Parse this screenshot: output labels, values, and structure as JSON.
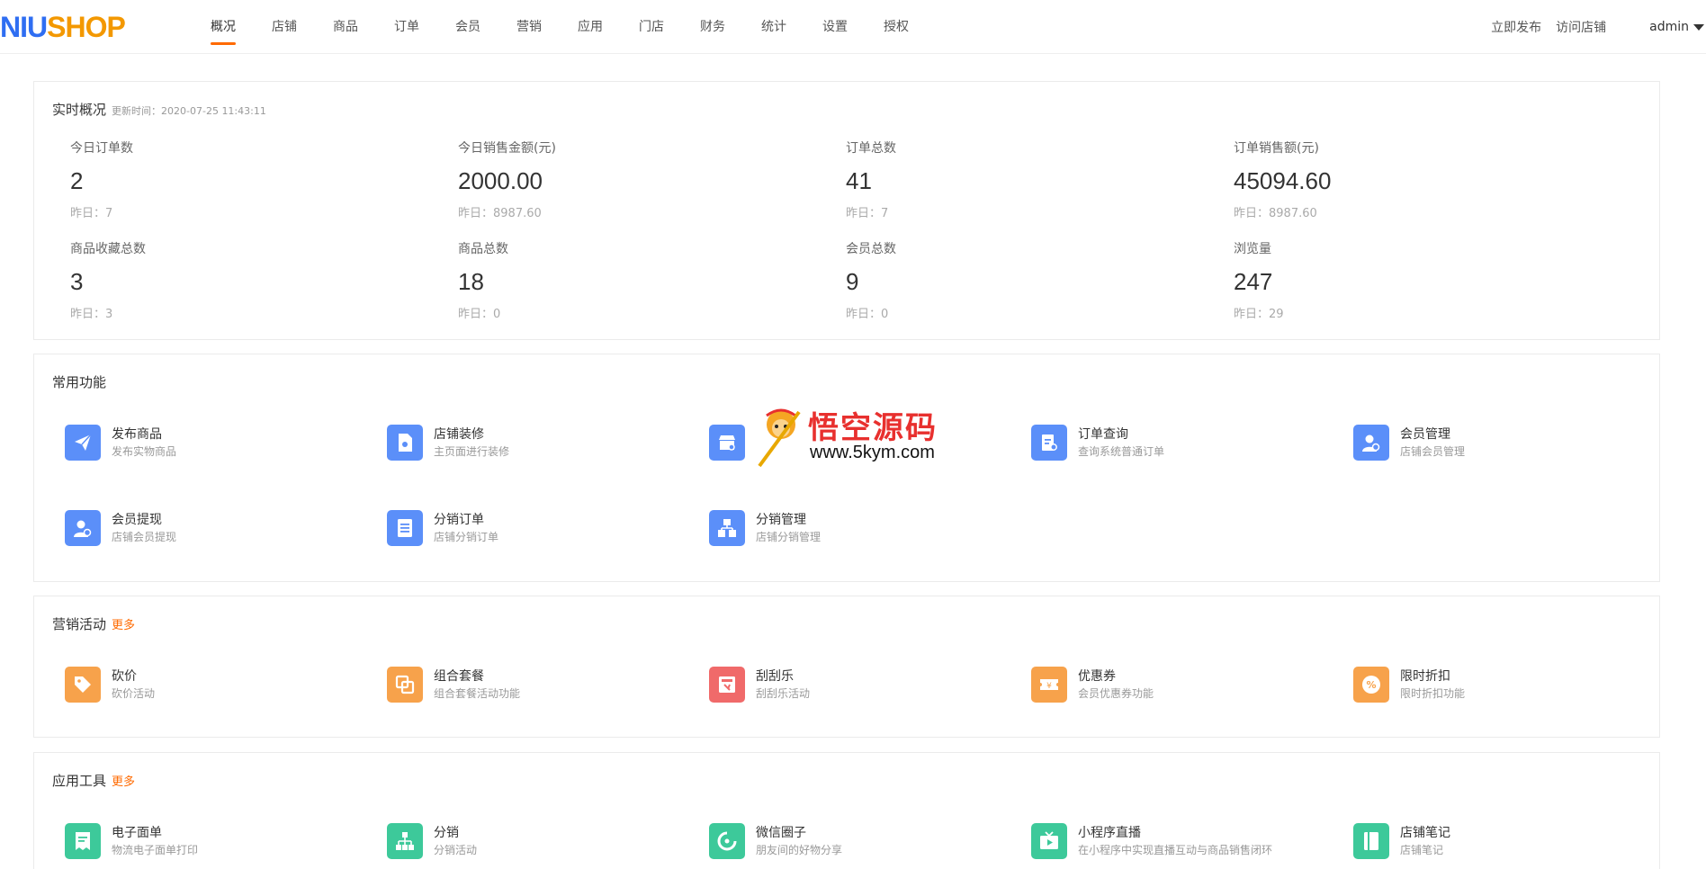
{
  "brand": {
    "logo_part1": "NIU",
    "logo_part2": "SHOP"
  },
  "nav": [
    "概况",
    "店铺",
    "商品",
    "订单",
    "会员",
    "营销",
    "应用",
    "门店",
    "财务",
    "统计",
    "设置",
    "授权"
  ],
  "nav_active_index": 0,
  "top_links": {
    "publish": "立即发布",
    "visit": "访问店铺",
    "user": "admin"
  },
  "realtime": {
    "title": "实时概况",
    "updated": "更新时间：2020-07-25 11:43:11",
    "stats": [
      {
        "label": "今日订单数",
        "value": "2",
        "yesterday": "昨日：7"
      },
      {
        "label": "今日销售金额(元)",
        "value": "2000.00",
        "yesterday": "昨日：8987.60"
      },
      {
        "label": "订单总数",
        "value": "41",
        "yesterday": "昨日：7"
      },
      {
        "label": "订单销售额(元)",
        "value": "45094.60",
        "yesterday": "昨日：8987.60"
      },
      {
        "label": "商品收藏总数",
        "value": "3",
        "yesterday": "昨日：3"
      },
      {
        "label": "商品总数",
        "value": "18",
        "yesterday": "昨日：0"
      },
      {
        "label": "会员总数",
        "value": "9",
        "yesterday": "昨日：0"
      },
      {
        "label": "浏览量",
        "value": "247",
        "yesterday": "昨日：29"
      }
    ]
  },
  "common": {
    "title": "常用功能",
    "items": [
      {
        "name": "发布商品",
        "desc": "发布实物商品",
        "icon": "paper-plane-icon",
        "color": "blue"
      },
      {
        "name": "店铺装修",
        "desc": "主页面进行装修",
        "icon": "page-design-icon",
        "color": "blue"
      },
      {
        "name": "",
        "desc": "",
        "icon": "store-icon",
        "color": "blue"
      },
      {
        "name": "订单查询",
        "desc": "查询系统普通订单",
        "icon": "order-search-icon",
        "color": "blue"
      },
      {
        "name": "会员管理",
        "desc": "店铺会员管理",
        "icon": "member-manage-icon",
        "color": "blue"
      },
      {
        "name": "会员提现",
        "desc": "店铺会员提现",
        "icon": "member-withdraw-icon",
        "color": "blue"
      },
      {
        "name": "分销订单",
        "desc": "店铺分销订单",
        "icon": "list-doc-icon",
        "color": "blue"
      },
      {
        "name": "分销管理",
        "desc": "店铺分销管理",
        "icon": "hierarchy-icon",
        "color": "blue"
      }
    ]
  },
  "marketing": {
    "title": "营销活动",
    "more": "更多",
    "items": [
      {
        "name": "砍价",
        "desc": "砍价活动",
        "icon": "tag-cut-icon",
        "color": "orange"
      },
      {
        "name": "组合套餐",
        "desc": "组合套餐活动功能",
        "icon": "combo-icon",
        "color": "orange"
      },
      {
        "name": "刮刮乐",
        "desc": "刮刮乐活动",
        "icon": "scratch-card-icon",
        "color": "red"
      },
      {
        "name": "优惠券",
        "desc": "会员优惠券功能",
        "icon": "coupon-icon",
        "color": "orange"
      },
      {
        "name": "限时折扣",
        "desc": "限时折扣功能",
        "icon": "percent-badge-icon",
        "color": "orange"
      }
    ]
  },
  "tools": {
    "title": "应用工具",
    "more": "更多",
    "items": [
      {
        "name": "电子面单",
        "desc": "物流电子面单打印",
        "icon": "waybill-icon",
        "color": "green"
      },
      {
        "name": "分销",
        "desc": "分销活动",
        "icon": "distribution-icon",
        "color": "green"
      },
      {
        "name": "微信圈子",
        "desc": "朋友间的好物分享",
        "icon": "circle-icon",
        "color": "green"
      },
      {
        "name": "小程序直播",
        "desc": "在小程序中实现直播互动与商品销售闭环",
        "icon": "live-tv-icon",
        "color": "green"
      },
      {
        "name": "店铺笔记",
        "desc": "店铺笔记",
        "icon": "notebook-icon",
        "color": "green"
      }
    ]
  },
  "watermark": {
    "title": "悟空源码",
    "url": "www.5kym.com"
  }
}
